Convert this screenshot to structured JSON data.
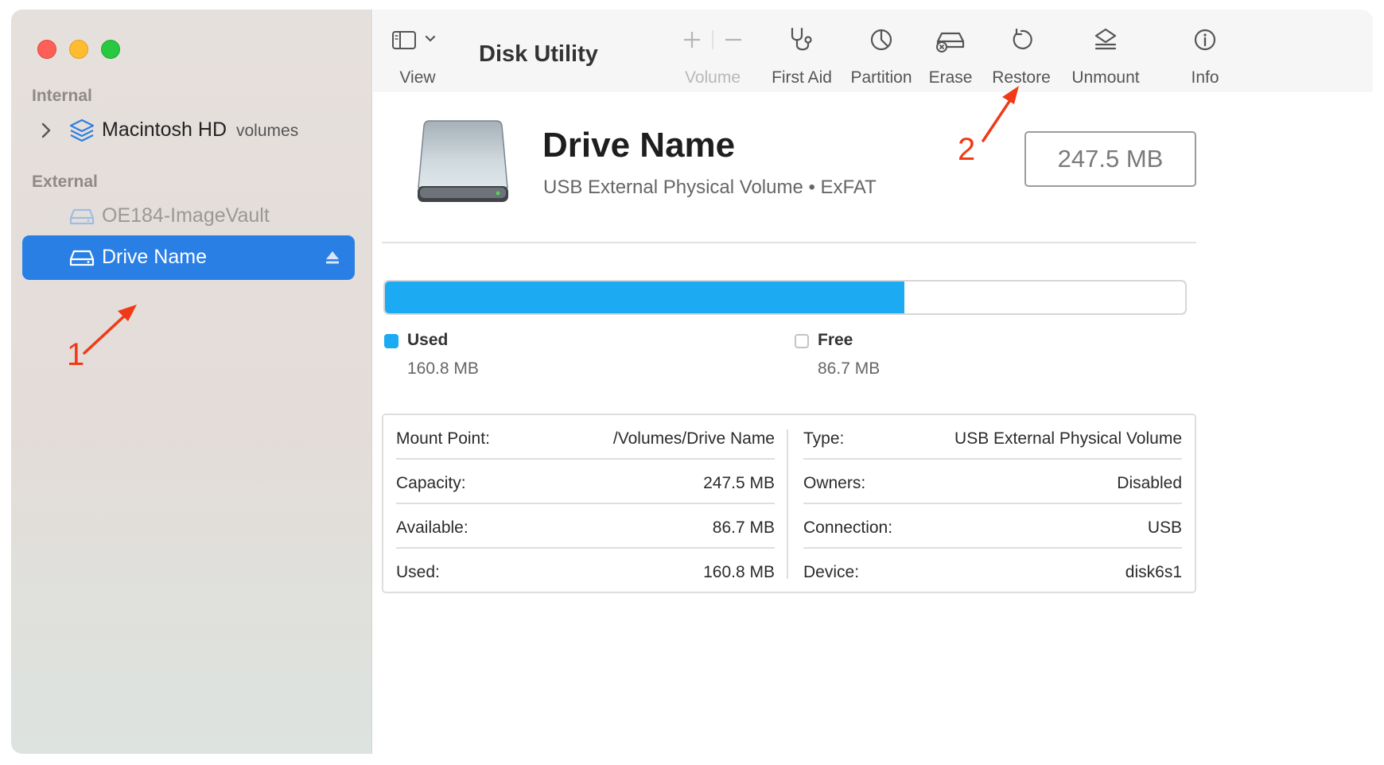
{
  "app": {
    "title": "Disk Utility"
  },
  "sidebar": {
    "sections": [
      {
        "label": "Internal"
      },
      {
        "label": "External"
      }
    ],
    "items": [
      {
        "name": "Macintosh HD",
        "sub": "volumes",
        "section": "Internal",
        "expandable": true,
        "icon": "layers-icon"
      },
      {
        "name": "OE184-ImageVault",
        "section": "External",
        "dimmed": true,
        "icon": "external-drive-icon"
      },
      {
        "name": "Drive Name",
        "section": "External",
        "selected": true,
        "icon": "external-drive-icon",
        "ejectable": true
      }
    ]
  },
  "toolbar": {
    "view": "View",
    "volume": "Volume",
    "first_aid": "First Aid",
    "partition": "Partition",
    "erase": "Erase",
    "restore": "Restore",
    "unmount": "Unmount",
    "info": "Info"
  },
  "drive": {
    "name": "Drive Name",
    "subtitle": "USB External Physical Volume • ExFAT",
    "capacity": "247.5 MB"
  },
  "usage": {
    "used_fraction": 0.649,
    "used_label": "Used",
    "used_value": "160.8 MB",
    "free_label": "Free",
    "free_value": "86.7 MB",
    "used_color": "#1cabf2"
  },
  "info": {
    "left": [
      {
        "key": "Mount Point:",
        "value": "/Volumes/Drive Name"
      },
      {
        "key": "Capacity:",
        "value": "247.5 MB"
      },
      {
        "key": "Available:",
        "value": "86.7 MB"
      },
      {
        "key": "Used:",
        "value": "160.8 MB"
      }
    ],
    "right": [
      {
        "key": "Type:",
        "value": "USB External Physical Volume"
      },
      {
        "key": "Owners:",
        "value": "Disabled"
      },
      {
        "key": "Connection:",
        "value": "USB"
      },
      {
        "key": "Device:",
        "value": "disk6s1"
      }
    ]
  },
  "annotations": {
    "step1": "1",
    "step2": "2",
    "color": "#f03a17"
  }
}
